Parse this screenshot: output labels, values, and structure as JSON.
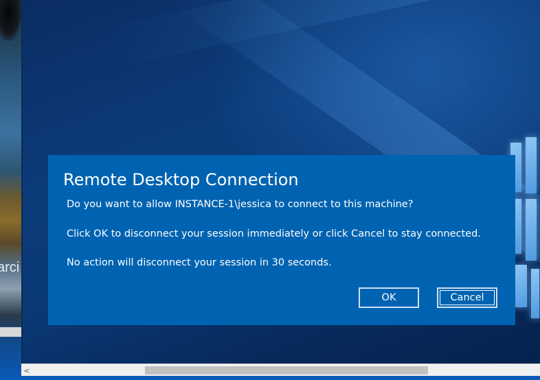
{
  "background": {
    "left_partial_text": "arci",
    "accent_color": "#0063b1"
  },
  "dialog": {
    "title": "Remote Desktop Connection",
    "messages": [
      "Do you want to allow INSTANCE-1\\jessica to connect to this machine?",
      "Click OK to disconnect your session immediately or click Cancel to stay connected.",
      "No action will disconnect your session in 30 seconds."
    ],
    "ok_label": "OK",
    "cancel_label": "Cancel"
  },
  "scrollbar": {
    "left_arrow_icon": "chevron-left-icon",
    "left_arrow_glyph": "<"
  }
}
